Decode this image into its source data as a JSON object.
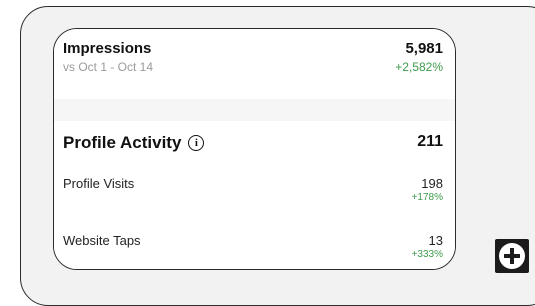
{
  "impressions": {
    "title": "Impressions",
    "value": "5,981",
    "comparison": "vs Oct 1 - Oct 14",
    "change": "+2,582%"
  },
  "profile_activity": {
    "title": "Profile Activity",
    "info_icon": "ⓘ",
    "value": "211",
    "metrics": [
      {
        "label": "Profile Visits",
        "value": "198",
        "change": "+178%"
      },
      {
        "label": "Website Taps",
        "value": "13",
        "change": "+333%"
      }
    ]
  },
  "icons": {
    "info": "info-icon",
    "add": "plus-icon"
  },
  "colors": {
    "positive": "#3f9a4b",
    "muted": "#9a9a9a"
  }
}
